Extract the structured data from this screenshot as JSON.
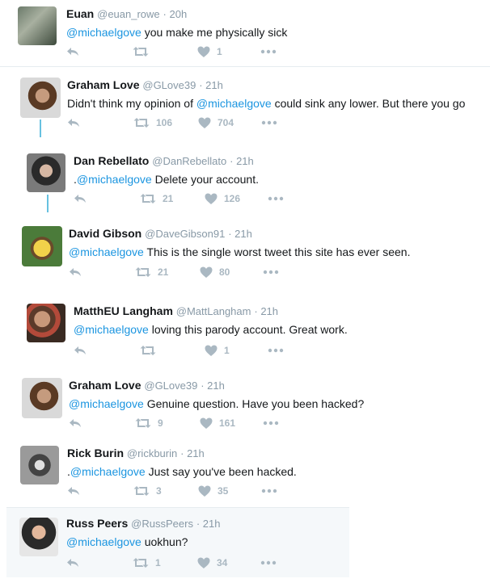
{
  "tweets": [
    {
      "name": "Euan",
      "handle": "@euan_rowe",
      "time": "· 20h",
      "mention": "@michaelgove",
      "prefix": "",
      "text": " you make me physically sick",
      "retweets": "",
      "likes": "1"
    },
    {
      "name": "Graham Love",
      "handle": "@GLove39",
      "time": "· 21h",
      "mention": "@michaelgove",
      "prefix": "Didn't think my opinion of ",
      "text": " could sink any lower. But there you go",
      "retweets": "106",
      "likes": "704"
    },
    {
      "name": "Dan Rebellato",
      "handle": "@DanRebellato",
      "time": "· 21h",
      "mention": "@michaelgove",
      "prefix": ".",
      "text": " Delete your account.",
      "retweets": "21",
      "likes": "126"
    },
    {
      "name": "David Gibson",
      "handle": "@DaveGibson91",
      "time": "· 21h",
      "mention": "@michaelgove",
      "prefix": "",
      "text": " This is the single worst tweet this site has ever seen.",
      "retweets": "21",
      "likes": "80"
    },
    {
      "name": "MatthEU Langham",
      "handle": "@MattLangham",
      "time": "· 21h",
      "mention": "@michaelgove",
      "prefix": "",
      "text": " loving this parody account. Great work.",
      "retweets": "",
      "likes": "1"
    },
    {
      "name": "Graham Love",
      "handle": "@GLove39",
      "time": "· 21h",
      "mention": "@michaelgove",
      "prefix": "",
      "text": " Genuine question. Have you been hacked?",
      "retweets": "9",
      "likes": "161"
    },
    {
      "name": "Rick Burin",
      "handle": "@rickburin",
      "time": "· 21h",
      "mention": "@michaelgove",
      "prefix": ".",
      "text": " Just say you've been hacked.",
      "retweets": "3",
      "likes": "35"
    },
    {
      "name": "Russ Peers",
      "handle": "@RussPeers",
      "time": "· 21h",
      "mention": "@michaelgove",
      "prefix": "",
      "text": " uokhun?",
      "retweets": "1",
      "likes": "34"
    }
  ],
  "icons": {
    "reply": "reply-icon",
    "retweet": "retweet-icon",
    "like": "heart-icon",
    "more": "more-icon"
  },
  "colors": {
    "mention": "#1b95e0",
    "thread": "#67c1e0",
    "muted": "#aab8c2",
    "highlight_bg": "#f5f8fa"
  }
}
